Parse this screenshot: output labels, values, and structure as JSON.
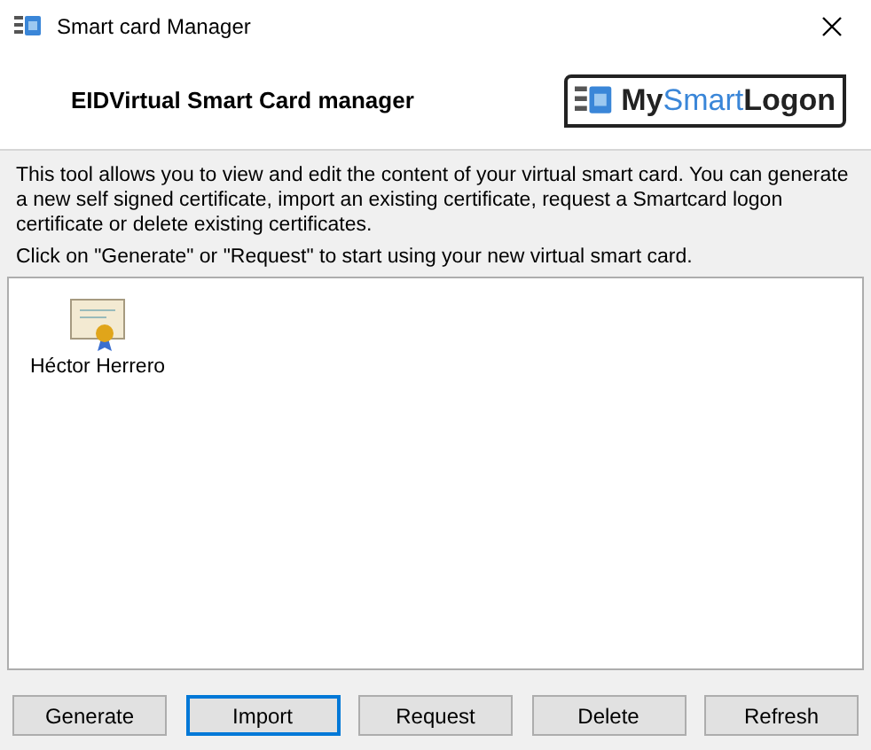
{
  "window": {
    "title": "Smart card Manager"
  },
  "header": {
    "title": "EIDVirtual Smart Card manager",
    "logo": {
      "part_1": "My",
      "part_2": "Smart",
      "part_3": "Logon"
    }
  },
  "description": "This tool allows you to view and edit the content of your virtual smart card. You can generate a new self signed certificate, import an existing certificate, request a Smartcard logon certificate or delete existing certificates.",
  "hint": "Click on \"Generate\" or \"Request\" to start using your new virtual smart card.",
  "certificates": [
    {
      "label": "Héctor Herrero",
      "selected": false
    }
  ],
  "buttons": [
    {
      "label": "Generate",
      "focused": false
    },
    {
      "label": "Import",
      "focused": true
    },
    {
      "label": "Request",
      "focused": false
    },
    {
      "label": "Delete",
      "focused": false
    },
    {
      "label": "Refresh",
      "focused": false
    }
  ]
}
